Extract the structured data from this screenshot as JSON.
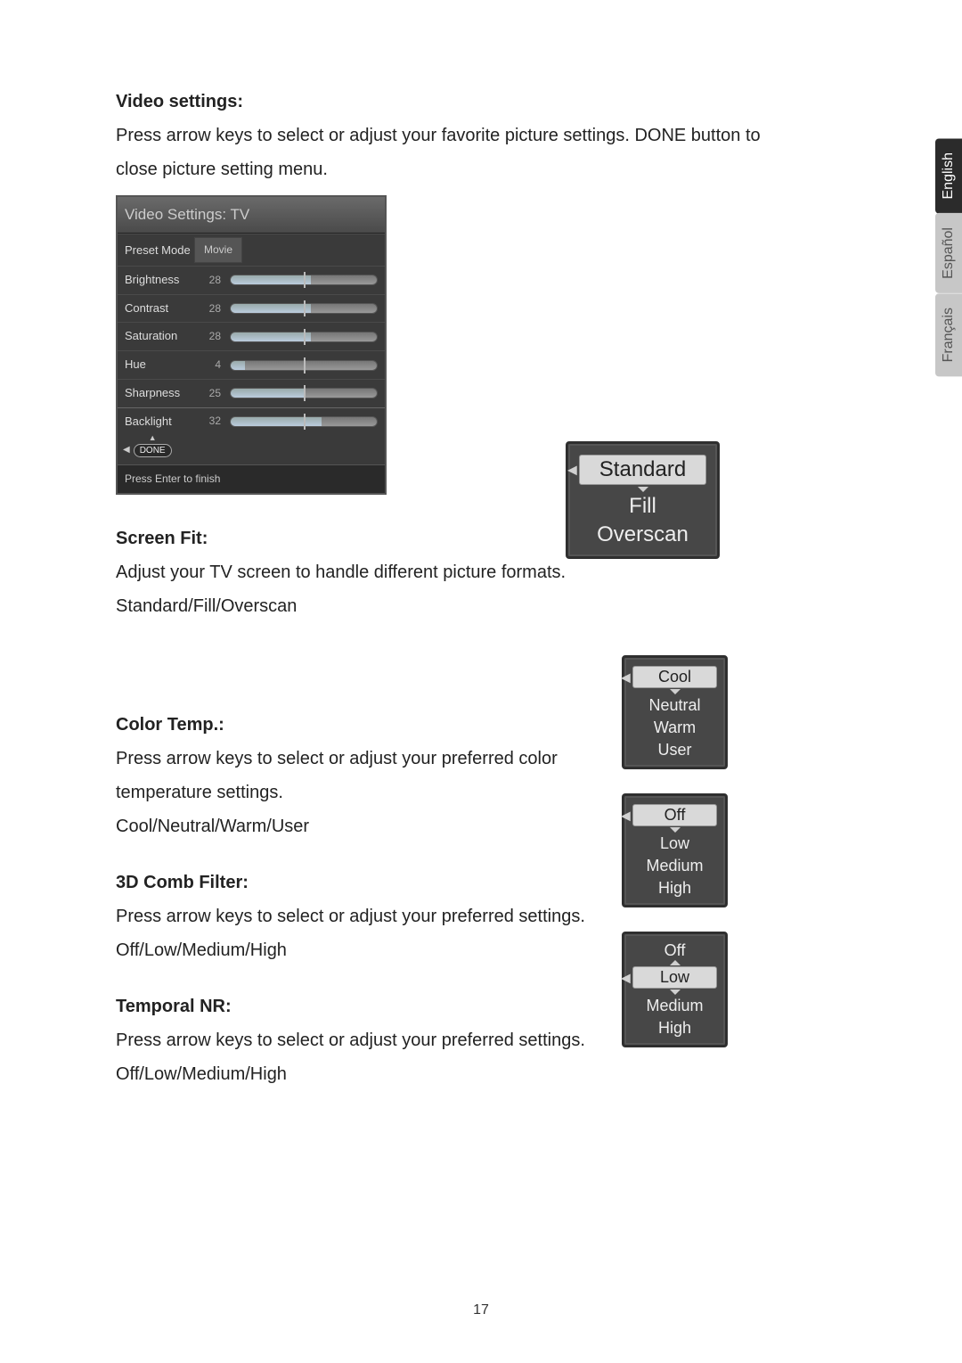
{
  "lang_tabs": {
    "english": "English",
    "espanol": "Español",
    "francais": "Français"
  },
  "sections": {
    "video": {
      "heading": "Video settings:",
      "body1": "Press arrow keys to select or adjust your favorite picture settings. DONE button to",
      "body2": "close picture setting menu."
    },
    "screenfit": {
      "heading": "Screen Fit:",
      "body1": "Adjust your TV screen to handle different picture formats.",
      "body2": "Standard/Fill/Overscan"
    },
    "colortemp": {
      "heading": "Color Temp.:",
      "body1": "Press arrow keys to select or adjust your preferred color",
      "body2": "temperature settings.",
      "body3": "Cool/Neutral/Warm/User"
    },
    "comb": {
      "heading": "3D Comb Filter:",
      "body1": "Press arrow keys to select or adjust your preferred settings.",
      "body2": "Off/Low/Medium/High"
    },
    "temporal": {
      "heading": "Temporal NR:",
      "body1": "Press arrow keys to select or adjust your preferred settings.",
      "body2": "Off/Low/Medium/High"
    }
  },
  "video_panel": {
    "title": "Video Settings: TV",
    "preset_label": "Preset Mode",
    "preset_value": "Movie",
    "rows": [
      {
        "label": "Brightness",
        "value": "28"
      },
      {
        "label": "Contrast",
        "value": "28"
      },
      {
        "label": "Saturation",
        "value": "28"
      },
      {
        "label": "Hue",
        "value": "4"
      },
      {
        "label": "Sharpness",
        "value": "25"
      },
      {
        "label": "Backlight",
        "value": "32"
      }
    ],
    "done_label": "DONE",
    "footer": "Press Enter to finish"
  },
  "menus": {
    "screenfit": {
      "selected": "Standard",
      "opts": [
        "Fill",
        "Overscan"
      ]
    },
    "colortemp": {
      "selected": "Cool",
      "opts": [
        "Neutral",
        "Warm",
        "User"
      ]
    },
    "comb": {
      "selected": "Off",
      "opts": [
        "Low",
        "Medium",
        "High"
      ]
    },
    "temporal": {
      "pre": "Off",
      "selected": "Low",
      "opts": [
        "Medium",
        "High"
      ]
    }
  },
  "page_number": "17"
}
